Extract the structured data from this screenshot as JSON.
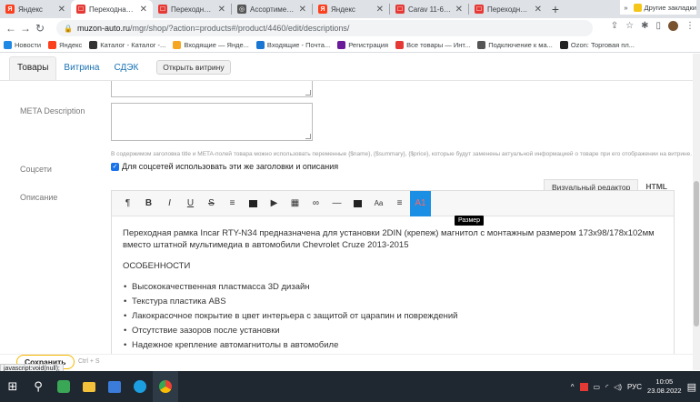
{
  "browser": {
    "tabs": [
      {
        "title": "Яндекс",
        "color": "#fc3f1d",
        "glyph": "Я"
      },
      {
        "title": "Переходная рамк",
        "color": "#e53935",
        "glyph": "☐",
        "active": true
      },
      {
        "title": "Переходная рам",
        "color": "#e53935",
        "glyph": "☐"
      },
      {
        "title": "Ассортимент ма",
        "color": "#555555",
        "glyph": "◎"
      },
      {
        "title": "Яндекс",
        "color": "#fc3f1d",
        "glyph": "Я"
      },
      {
        "title": "Carav 11-603 | 2(",
        "color": "#e53935",
        "glyph": "☐"
      },
      {
        "title": "Переходная рам",
        "color": "#e53935",
        "glyph": "☐"
      }
    ],
    "url_host": "muzon-auto.ru",
    "url_path": "/mgr/shop/?action=products#/product/4460/edit/descriptions/",
    "bookmarks": [
      {
        "label": "Новости",
        "color": "#1e88e5"
      },
      {
        "label": "Яндекс",
        "color": "#fc3f1d"
      },
      {
        "label": "Каталог - Каталог -...",
        "color": "#333333"
      },
      {
        "label": "Входящие — Янде...",
        "color": "#f5a623"
      },
      {
        "label": "Входящие - Почта...",
        "color": "#1976d2"
      },
      {
        "label": "Регистрация",
        "color": "#6a1b9a"
      },
      {
        "label": "Все товары — Инт...",
        "color": "#e53935"
      },
      {
        "label": "Подключение к ма...",
        "color": "#555555"
      },
      {
        "label": "Ozon: Торговая пл...",
        "color": "#222222"
      }
    ],
    "bookmarks_more": "»",
    "bookmarks_other": "Другие закладки"
  },
  "app": {
    "tabs": [
      "Товары",
      "Витрина",
      "СДЭК"
    ],
    "open_storefront": "Открыть витрину",
    "meta_description_label": "META Description",
    "hint": "В содержимом заголовка title и META-полей товара можно использовать переменные {$name}, {$summary}, {$price}, которые будут заменены актуальной информацией о товаре при его отображении на витрине.",
    "social_label": "Соцсети",
    "social_checkbox": "Для соцсетей использовать эти же заголовки и описания",
    "description_label": "Описание",
    "editor_tabs": {
      "visual": "Визуальный редактор",
      "html": "HTML"
    },
    "toolbar": [
      {
        "name": "paragraph-icon",
        "glyph": "¶"
      },
      {
        "name": "bold-icon",
        "glyph": "B"
      },
      {
        "name": "italic-icon",
        "glyph": "I"
      },
      {
        "name": "underline-icon",
        "glyph": "U"
      },
      {
        "name": "strikethrough-icon",
        "glyph": "S"
      },
      {
        "name": "list-icon",
        "glyph": "≡"
      },
      {
        "name": "image-icon",
        "glyph": "▣"
      },
      {
        "name": "video-icon",
        "glyph": "▶"
      },
      {
        "name": "table-icon",
        "glyph": "▦"
      },
      {
        "name": "link-icon",
        "glyph": "∞"
      },
      {
        "name": "horizontal-rule-icon",
        "glyph": "—"
      },
      {
        "name": "font-color-icon",
        "glyph": "A"
      },
      {
        "name": "font-size-icon",
        "glyph": "Aa"
      },
      {
        "name": "align-icon",
        "glyph": "≡"
      },
      {
        "name": "size-icon",
        "glyph": "A1",
        "selected": true
      }
    ],
    "tooltip": "Размер",
    "body": {
      "intro": "Переходная рамка Incar RTY-N34 предназначена для установки 2DIN (крепеж) магнитол с монтажным размером 173х98/178х102мм вместо штатной мультимедиа в автомобили Chevrolet Cruze 2013-2015",
      "features_heading": "ОСОБЕННОСТИ",
      "features": [
        "Высококачественная пластмасса 3D дизайн",
        "Текстура пластика ABS",
        "Лакокрасочное покрытие в цвет интерьера с защитой от царапин и повреждений",
        "Отсутствие зазоров после установки",
        "Надежное крепление автомагнитолы в автомобиле"
      ]
    },
    "save_label": "Сохранить",
    "save_hint": "Ctrl + S",
    "status_url": "javascript:void(null);"
  },
  "taskbar": {
    "lang": "РУС",
    "time": "10:05",
    "date": "23.08.2022"
  }
}
